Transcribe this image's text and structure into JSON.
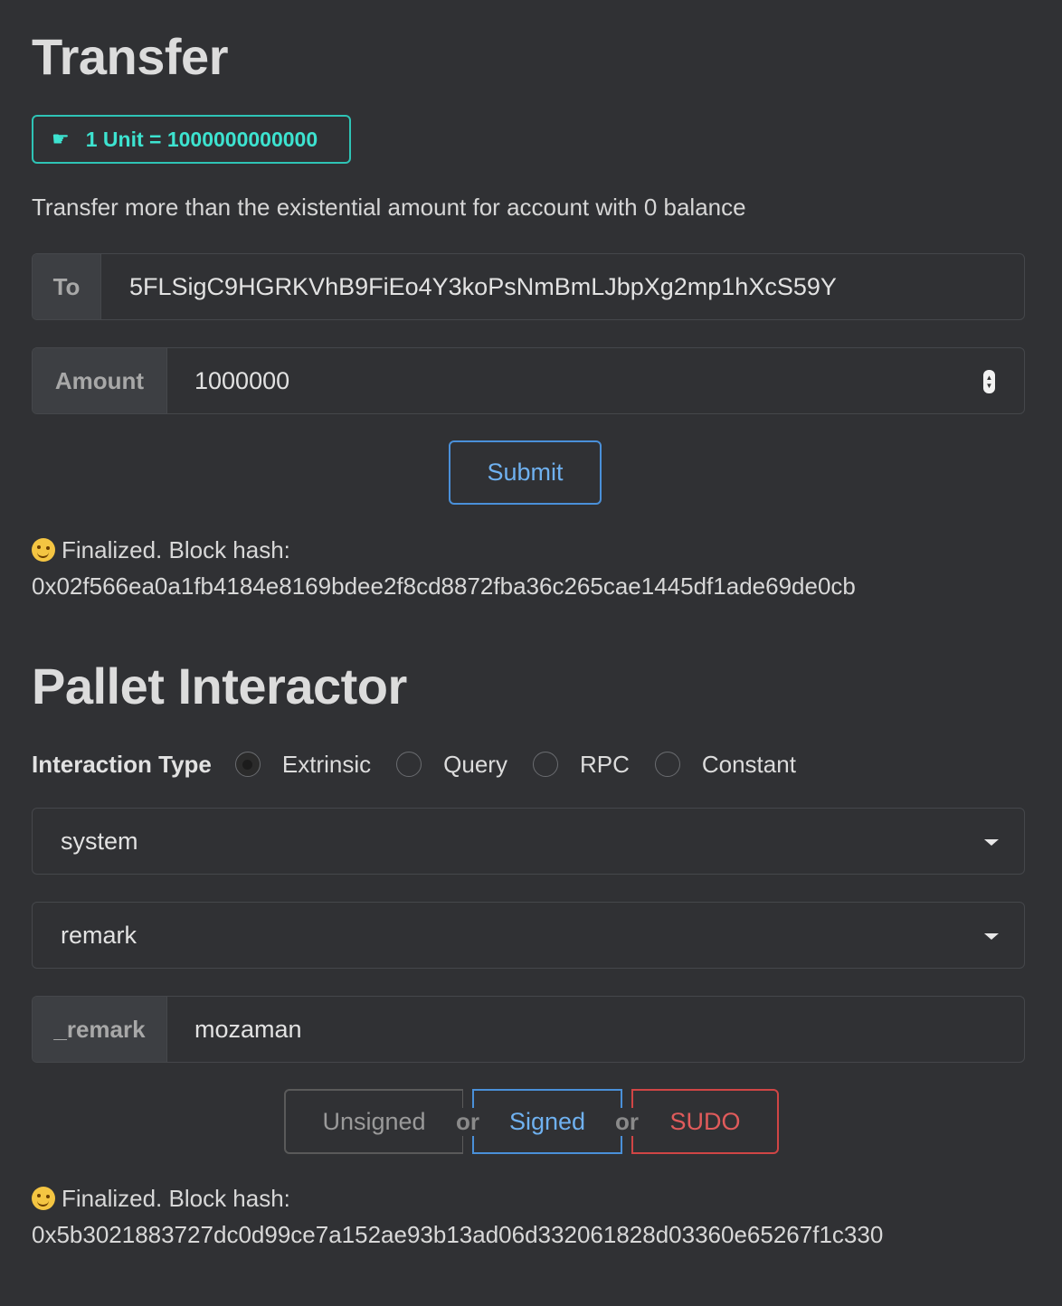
{
  "transfer": {
    "title": "Transfer",
    "unit_badge": "1 Unit = 1000000000000",
    "note": "Transfer more than the existential amount for account with 0 balance",
    "to_label": "To",
    "to_value": "5FLSigC9HGRKVhB9FiEo4Y3koPsNmBmLJbpXg2mp1hXcS59Y",
    "amount_label": "Amount",
    "amount_value": "1000000",
    "submit_label": "Submit",
    "status_line1": "Finalized. Block hash:",
    "status_hash": "0x02f566ea0a1fb4184e8169bdee2f8cd8872fba36c265cae1445df1ade69de0cb"
  },
  "pallet": {
    "title": "Pallet Interactor",
    "interaction_type_label": "Interaction Type",
    "options": [
      "Extrinsic",
      "Query",
      "RPC",
      "Constant"
    ],
    "selected_option": "Extrinsic",
    "pallet_value": "system",
    "callable_value": "remark",
    "param_label": "_remark",
    "param_value": "mozaman",
    "buttons": {
      "unsigned": "Unsigned",
      "or": "or",
      "signed": "Signed",
      "sudo": "SUDO"
    },
    "status_line1": "Finalized. Block hash:",
    "status_hash": "0x5b3021883727dc0d99ce7a152ae93b13ad06d332061828d03360e65267f1c330"
  },
  "colors": {
    "background": "#303134",
    "teal_accent": "#2ec4b6",
    "blue_accent": "#4a90d9",
    "red_accent": "#d04545"
  },
  "icons": [
    "hand-point-right-icon",
    "winking-face-icon",
    "chevron-down-icon",
    "number-spinner-icon"
  ]
}
